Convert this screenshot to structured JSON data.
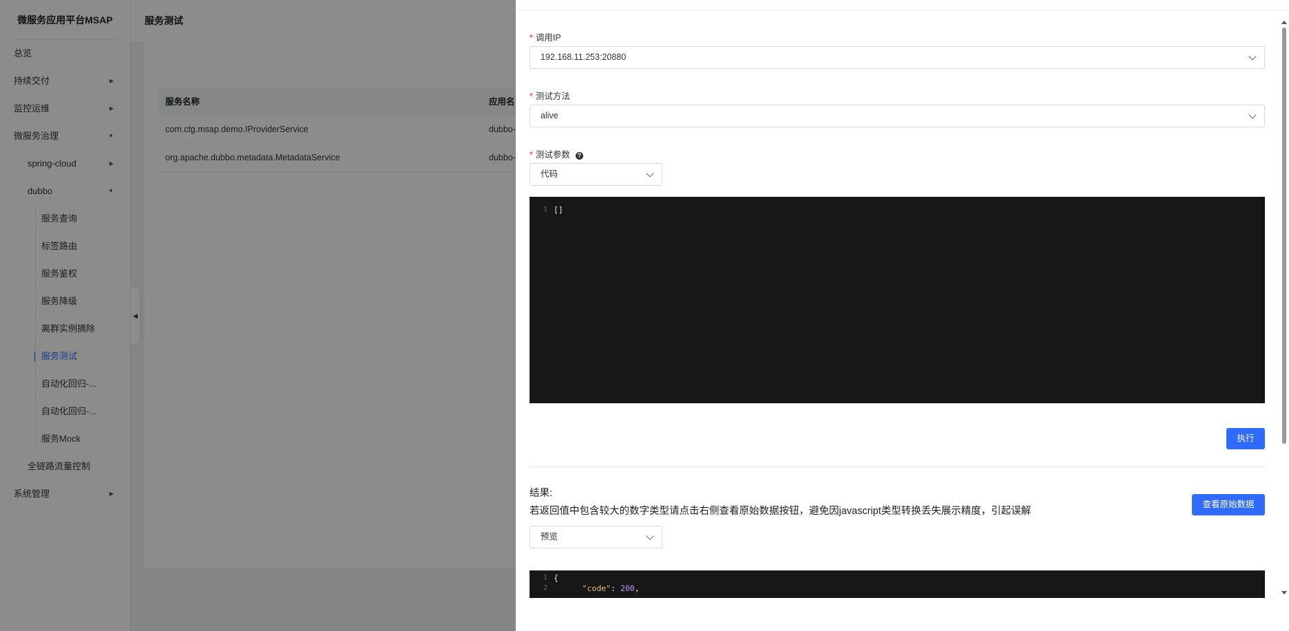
{
  "app": {
    "title": "微服务应用平台MSAP"
  },
  "sidebar": {
    "items": [
      {
        "label": "总览",
        "level": 1,
        "arrow": ""
      },
      {
        "label": "持续交付",
        "level": 1,
        "arrow": "caret-right-icon"
      },
      {
        "label": "监控运维",
        "level": 1,
        "arrow": "caret-right-icon"
      },
      {
        "label": "微服务治理",
        "level": 1,
        "arrow": "caret-down-icon"
      },
      {
        "label": "spring-cloud",
        "level": 2,
        "arrow": "caret-right-icon"
      },
      {
        "label": "dubbo",
        "level": 2,
        "arrow": "caret-down-icon"
      },
      {
        "label": "服务查询",
        "level": 3
      },
      {
        "label": "标签路由",
        "level": 3
      },
      {
        "label": "服务鉴权",
        "level": 3
      },
      {
        "label": "服务降级",
        "level": 3
      },
      {
        "label": "离群实例摘除",
        "level": 3
      },
      {
        "label": "服务测试",
        "level": 3,
        "active": true
      },
      {
        "label": "自动化回归-...",
        "level": 3
      },
      {
        "label": "自动化回归-...",
        "level": 3
      },
      {
        "label": "服务Mock",
        "level": 3
      },
      {
        "label": "全链路流量控制",
        "level": 2
      },
      {
        "label": "系统管理",
        "level": 1,
        "arrow": "caret-right-icon"
      }
    ]
  },
  "page": {
    "title": "服务测试",
    "table": {
      "headers": [
        "服务名称",
        "应用名"
      ],
      "rows": [
        [
          "com.ctg.msap.demo.IProviderService",
          "dubbo-"
        ],
        [
          "org.apache.dubbo.metadata.MetadataService",
          "dubbo-"
        ]
      ]
    }
  },
  "drawer": {
    "ip": {
      "label": "调用IP",
      "value": "192.168.11.253:20880"
    },
    "method": {
      "label": "测试方法",
      "value": "alive"
    },
    "params": {
      "label": "测试参数",
      "mode": "代码",
      "code_lines": [
        "[]"
      ]
    },
    "execute_label": "执行",
    "result": {
      "title": "结果:",
      "note": "若返回值中包含较大的数字类型请点击右侧查看原始数据按钮，避免因javascript类型转换丢失展示精度，引起误解",
      "raw_button": "查看原始数据",
      "mode": "预览",
      "code": [
        {
          "n": "1",
          "text": "{"
        },
        {
          "n": "2",
          "key": "\"code\"",
          "value": "200"
        }
      ]
    }
  },
  "colors": {
    "primary": "#2f6bff",
    "required": "#f5222d",
    "editor_bg": "#171717"
  }
}
